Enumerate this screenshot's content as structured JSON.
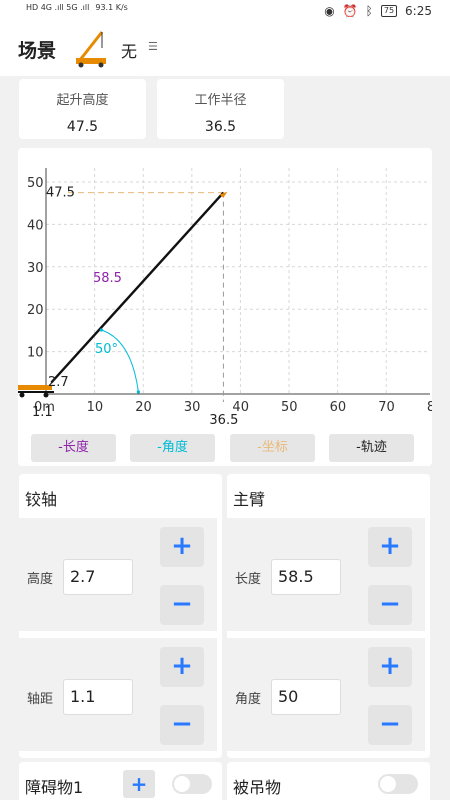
{
  "status": {
    "left_text": "HD 4G .ıll 5G .ıll",
    "speed": "93.1 K/s",
    "battery": "75",
    "time": "6:25"
  },
  "header": {
    "title": "场景",
    "selected_value": "无"
  },
  "stats": [
    {
      "label": "起升高度",
      "value": "47.5"
    },
    {
      "label": "工作半径",
      "value": "36.5"
    }
  ],
  "chart_data": {
    "type": "line",
    "x_ticks": [
      "0m",
      "10",
      "20",
      "30",
      "40",
      "50",
      "60",
      "70",
      "8"
    ],
    "y_ticks": [
      "10",
      "20",
      "30",
      "40",
      "50"
    ],
    "xlim": [
      0,
      80
    ],
    "ylim": [
      0,
      50
    ],
    "boom": {
      "x": [
        1.1,
        36.5
      ],
      "y": [
        2.7,
        47.5
      ]
    },
    "labels": {
      "tip_height": "47.5",
      "tip_radius": "36.5",
      "boom_length": "58.5",
      "angle": "50°",
      "pivot_height": "2.7",
      "pivot_distance": "1.1"
    }
  },
  "legend_chips": [
    {
      "label": "-长度",
      "color": "#8e24aa"
    },
    {
      "label": "-角度",
      "color": "#00bcd4"
    },
    {
      "label": "-坐标",
      "color": "#e8b97a"
    },
    {
      "label": "-轨迹",
      "color": "#222222"
    }
  ],
  "hinge": {
    "title": "铰轴",
    "height_label": "高度",
    "height_value": "2.7",
    "distance_label": "轴距",
    "distance_value": "1.1"
  },
  "boom": {
    "title": "主臂",
    "length_label": "长度",
    "length_value": "58.5",
    "angle_label": "角度",
    "angle_value": "50"
  },
  "buttons": {
    "plus": "+",
    "minus": "−"
  },
  "bottom": {
    "obstacle_label": "障碍物1",
    "load_label": "被吊物"
  },
  "colors": {
    "accent": "#2979ff",
    "length": "#8e24aa",
    "angle": "#00bcd4",
    "coord": "#e8b97a"
  }
}
